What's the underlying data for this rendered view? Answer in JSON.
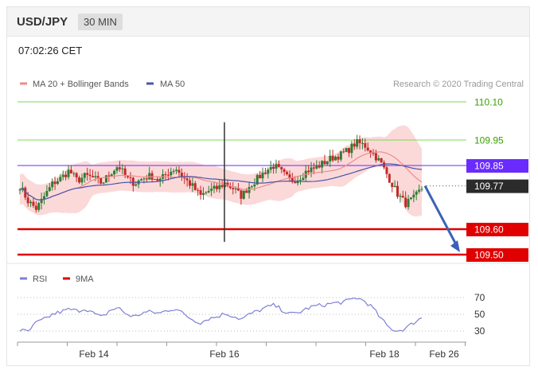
{
  "header": {
    "pair": "USD/JPY",
    "timeframe": "30 MIN"
  },
  "timestamp": "07:02:26 CET",
  "credit": "Research © 2020 Trading Central",
  "colors": {
    "up_candle": "#2e7d32",
    "down_candle": "#c62828",
    "ma20": "#f08a8a",
    "ma50": "#4a55a8",
    "bands": "#f9cccc",
    "green_level": "#7ed957",
    "blue_level": "#6a2bff",
    "red_level": "#e00000",
    "current": "#2b2b2b",
    "arrow": "#3a63b8",
    "rsi": "#7f7fd6",
    "rsi_ma": "#e00000"
  },
  "chart_data": [
    {
      "type": "candlestick",
      "title": "",
      "legend": [
        {
          "name": "MA 20 + Bollinger Bands",
          "color": "#f08a8a"
        },
        {
          "name": "MA 50",
          "color": "#4a55a8"
        }
      ],
      "legend_placement": "top-left",
      "ylim": [
        109.47,
        110.16
      ],
      "x_ticks": [
        "Feb 14",
        "Feb 16",
        "Feb 18",
        "Feb 26"
      ],
      "levels": [
        {
          "value": 110.1,
          "label": "110.10",
          "style": "green"
        },
        {
          "value": 109.95,
          "label": "109.95",
          "style": "green"
        },
        {
          "value": 109.85,
          "label": "109.85",
          "style": "blue"
        },
        {
          "value": 109.77,
          "label": "109.77",
          "style": "current"
        },
        {
          "value": 109.6,
          "label": "109.60",
          "style": "red"
        },
        {
          "value": 109.5,
          "label": "109.50",
          "style": "red"
        }
      ],
      "anchors": [
        109.77,
        109.71,
        109.68,
        109.73,
        109.78,
        109.8,
        109.83,
        109.79,
        109.81,
        109.8,
        109.78,
        109.82,
        109.85,
        109.8,
        109.78,
        109.8,
        109.81,
        109.79,
        109.82,
        109.84,
        109.8,
        109.77,
        109.73,
        109.75,
        109.76,
        109.78,
        109.76,
        109.73,
        109.77,
        109.8,
        109.83,
        109.85,
        109.82,
        109.79,
        109.8,
        109.83,
        109.84,
        109.86,
        109.88,
        109.89,
        109.91,
        109.94,
        109.93,
        109.9,
        109.86,
        109.8,
        109.74,
        109.7,
        109.72,
        109.76
      ],
      "forecast": {
        "from": 109.77,
        "to": 109.5
      }
    },
    {
      "type": "line",
      "title": "",
      "legend": [
        {
          "name": "RSI",
          "color": "#7f7fd6"
        },
        {
          "name": "9MA",
          "color": "#e00000"
        }
      ],
      "legend_placement": "top-left",
      "ylim": [
        20,
        80
      ],
      "y_ticks": [
        "70",
        "50",
        "30"
      ],
      "rsi_anchors": [
        31,
        29,
        40,
        44,
        50,
        53,
        56,
        54,
        57,
        51,
        46,
        55,
        58,
        50,
        47,
        52,
        53,
        51,
        55,
        57,
        50,
        44,
        40,
        45,
        47,
        51,
        48,
        44,
        50,
        54,
        58,
        61,
        55,
        50,
        52,
        57,
        60,
        61,
        63,
        64,
        66,
        70,
        66,
        58,
        45,
        34,
        30,
        33,
        40,
        46
      ]
    }
  ]
}
